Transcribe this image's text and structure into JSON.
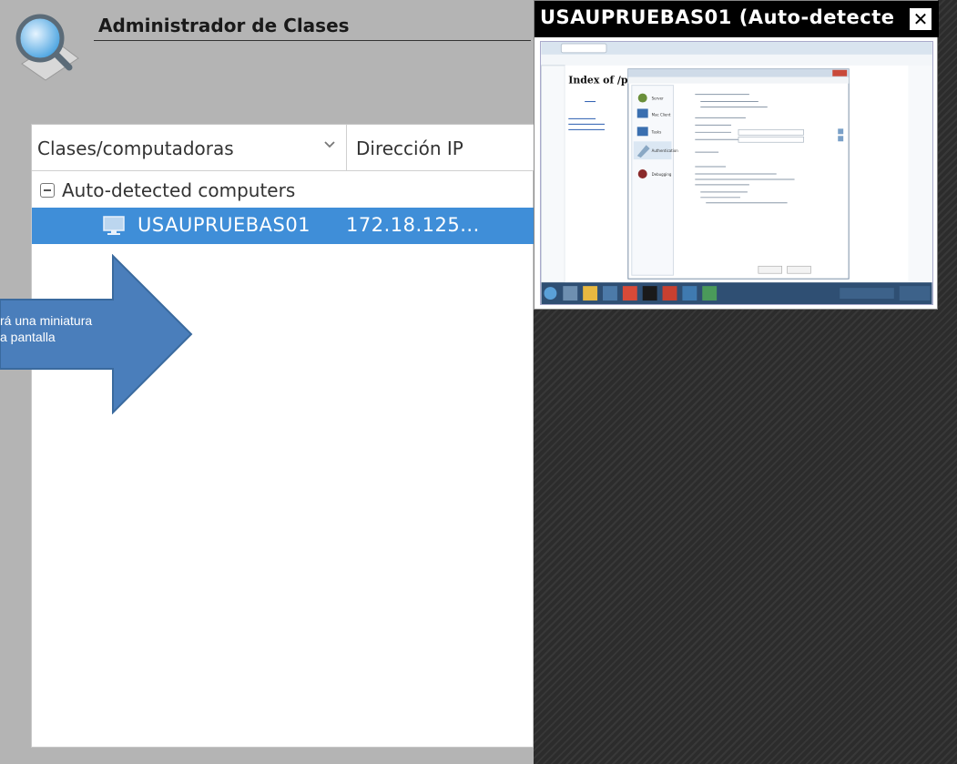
{
  "app": {
    "title": "Administrador de Clases"
  },
  "tree": {
    "columns": {
      "classes": "Clases/computadoras",
      "ip": "Dirección IP"
    },
    "group": {
      "label": "Auto-detected computers"
    },
    "computers": [
      {
        "name": "USAUPRUEBAS01",
        "ip": "172.18.125..."
      }
    ]
  },
  "callout": {
    "line1": "rá una miniatura",
    "line2": "a pantalla"
  },
  "preview": {
    "title": "USAUPRUEBAS01 (Auto-detecte",
    "close_label": "✕",
    "inner_window": {
      "heading": "Index of /publ",
      "dialog_menu": [
        "Server",
        "Mac Client",
        "Tasks",
        "Authentication",
        "Debugging"
      ]
    }
  },
  "colors": {
    "selection": "#3f8ed8",
    "arrow": "#4a7ebb"
  },
  "icons": [
    "magnifier-icon",
    "chevron-down-icon",
    "collapse-icon",
    "monitor-icon",
    "arrow-right-icon",
    "close-icon"
  ]
}
